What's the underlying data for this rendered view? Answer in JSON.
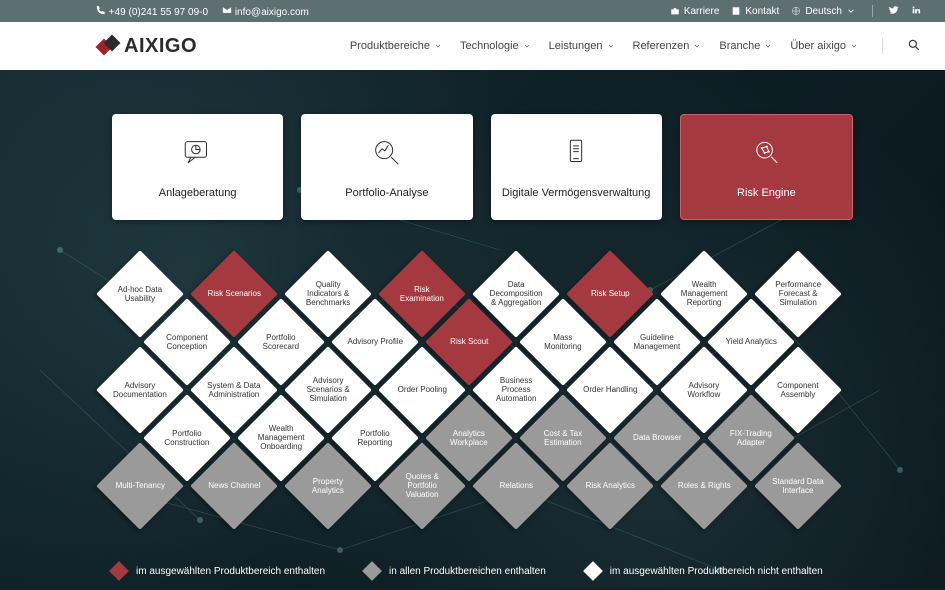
{
  "topbar": {
    "phone": "+49 (0)241 55 97 09-0",
    "email": "info@aixigo.com",
    "career": "Karriere",
    "contact": "Kontakt",
    "language": "Deutsch"
  },
  "brand": "aixigo",
  "nav": {
    "items": [
      {
        "label": "Produktbereiche"
      },
      {
        "label": "Technologie"
      },
      {
        "label": "Leistungen"
      },
      {
        "label": "Referenzen"
      },
      {
        "label": "Branche"
      },
      {
        "label": "Über aixigo"
      }
    ]
  },
  "cards": [
    {
      "id": "anlageberatung",
      "label": "Anlageberatung",
      "active": false
    },
    {
      "id": "portfolio-analyse",
      "label": "Portfolio-Analyse",
      "active": false
    },
    {
      "id": "digitale-vermoegensverwaltung",
      "label": "Digitale Vermögensverwaltung",
      "active": false
    },
    {
      "id": "risk-engine",
      "label": "Risk Engine",
      "active": true
    }
  ],
  "grid": [
    {
      "row": 0,
      "col": 0,
      "label": "Ad-hoc Data Usability",
      "color": "white"
    },
    {
      "row": 0,
      "col": 1,
      "label": "Risk Scenarios",
      "color": "red"
    },
    {
      "row": 0,
      "col": 2,
      "label": "Quality Indicators & Benchmarks",
      "color": "white"
    },
    {
      "row": 0,
      "col": 3,
      "label": "Risk Examination",
      "color": "red"
    },
    {
      "row": 0,
      "col": 4,
      "label": "Data Decomposition & Aggregation",
      "color": "white"
    },
    {
      "row": 0,
      "col": 5,
      "label": "Risk Setup",
      "color": "red"
    },
    {
      "row": 0,
      "col": 6,
      "label": "Wealth Management Reporting",
      "color": "white"
    },
    {
      "row": 0,
      "col": 7,
      "label": "Performance Forecast & Simulation",
      "color": "white"
    },
    {
      "row": 1,
      "col": 0,
      "label": "Component Conception",
      "color": "white",
      "offset": true
    },
    {
      "row": 1,
      "col": 1,
      "label": "Portfolio Scorecard",
      "color": "white",
      "offset": true
    },
    {
      "row": 1,
      "col": 2,
      "label": "Advisory Profile",
      "color": "white",
      "offset": true
    },
    {
      "row": 1,
      "col": 3,
      "label": "Risk Scout",
      "color": "red",
      "offset": true
    },
    {
      "row": 1,
      "col": 4,
      "label": "Mass Monitoring",
      "color": "white",
      "offset": true
    },
    {
      "row": 1,
      "col": 5,
      "label": "Guideline Management",
      "color": "white",
      "offset": true
    },
    {
      "row": 1,
      "col": 6,
      "label": "Yield Analytics",
      "color": "white",
      "offset": true
    },
    {
      "row": 2,
      "col": 0,
      "label": "Advisory Documentation",
      "color": "white"
    },
    {
      "row": 2,
      "col": 1,
      "label": "System & Data Administration",
      "color": "white"
    },
    {
      "row": 2,
      "col": 2,
      "label": "Advisory Scenarios & Simulation",
      "color": "white"
    },
    {
      "row": 2,
      "col": 3,
      "label": "Order Pooling",
      "color": "white"
    },
    {
      "row": 2,
      "col": 4,
      "label": "Business Process Automation",
      "color": "white"
    },
    {
      "row": 2,
      "col": 5,
      "label": "Order Handling",
      "color": "white"
    },
    {
      "row": 2,
      "col": 6,
      "label": "Advisory Workflow",
      "color": "white"
    },
    {
      "row": 2,
      "col": 7,
      "label": "Component Assembly",
      "color": "white"
    },
    {
      "row": 3,
      "col": 0,
      "label": "Portfolio Construction",
      "color": "white",
      "offset": true
    },
    {
      "row": 3,
      "col": 1,
      "label": "Wealth Management Onboarding",
      "color": "white",
      "offset": true
    },
    {
      "row": 3,
      "col": 2,
      "label": "Portfolio Reporting",
      "color": "white",
      "offset": true
    },
    {
      "row": 3,
      "col": 3,
      "label": "Analytics Workplace",
      "color": "gray",
      "offset": true
    },
    {
      "row": 3,
      "col": 4,
      "label": "Cost & Tax Estimation",
      "color": "gray",
      "offset": true
    },
    {
      "row": 3,
      "col": 5,
      "label": "Data Browser",
      "color": "gray",
      "offset": true
    },
    {
      "row": 3,
      "col": 6,
      "label": "FIX-Trading Adapter",
      "color": "gray",
      "offset": true
    },
    {
      "row": 4,
      "col": 0,
      "label": "Multi-Tenancy",
      "color": "gray"
    },
    {
      "row": 4,
      "col": 1,
      "label": "News Channel",
      "color": "gray"
    },
    {
      "row": 4,
      "col": 2,
      "label": "Property Analytics",
      "color": "gray"
    },
    {
      "row": 4,
      "col": 3,
      "label": "Quotes & Portfolio Valuation",
      "color": "gray"
    },
    {
      "row": 4,
      "col": 4,
      "label": "Relations",
      "color": "gray"
    },
    {
      "row": 4,
      "col": 5,
      "label": "Risk Analytics",
      "color": "gray"
    },
    {
      "row": 4,
      "col": 6,
      "label": "Roles & Rights",
      "color": "gray"
    },
    {
      "row": 4,
      "col": 7,
      "label": "Standard Data Interface",
      "color": "gray"
    }
  ],
  "legend": {
    "red": "im ausgewählten Produktbereich enthalten",
    "gray": "in allen Produktbereichen enthalten",
    "white": "im ausgewählten Produktbereich nicht enthalten"
  }
}
